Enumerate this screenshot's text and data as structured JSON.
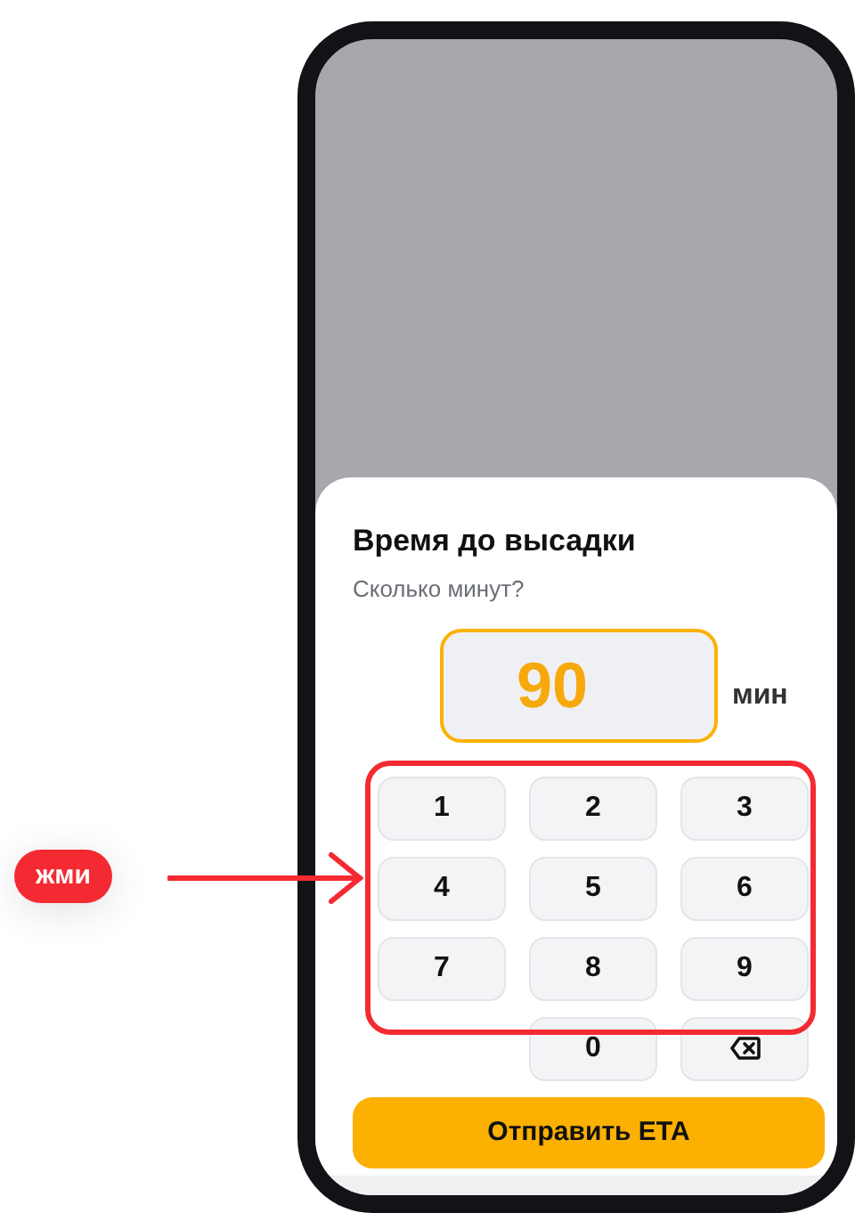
{
  "annotation": {
    "label": "жми"
  },
  "sheet": {
    "title": "Время до высадки",
    "subtitle": "Сколько минут?",
    "value": "90",
    "unit": "мин"
  },
  "keypad": [
    {
      "kind": "digit",
      "label": "1"
    },
    {
      "kind": "digit",
      "label": "2"
    },
    {
      "kind": "digit",
      "label": "3"
    },
    {
      "kind": "digit",
      "label": "4"
    },
    {
      "kind": "digit",
      "label": "5"
    },
    {
      "kind": "digit",
      "label": "6"
    },
    {
      "kind": "digit",
      "label": "7"
    },
    {
      "kind": "digit",
      "label": "8"
    },
    {
      "kind": "digit",
      "label": "9"
    },
    {
      "kind": "spacer"
    },
    {
      "kind": "digit",
      "label": "0"
    },
    {
      "kind": "backspace"
    }
  ],
  "submit": {
    "label": "Отправить ETA"
  }
}
